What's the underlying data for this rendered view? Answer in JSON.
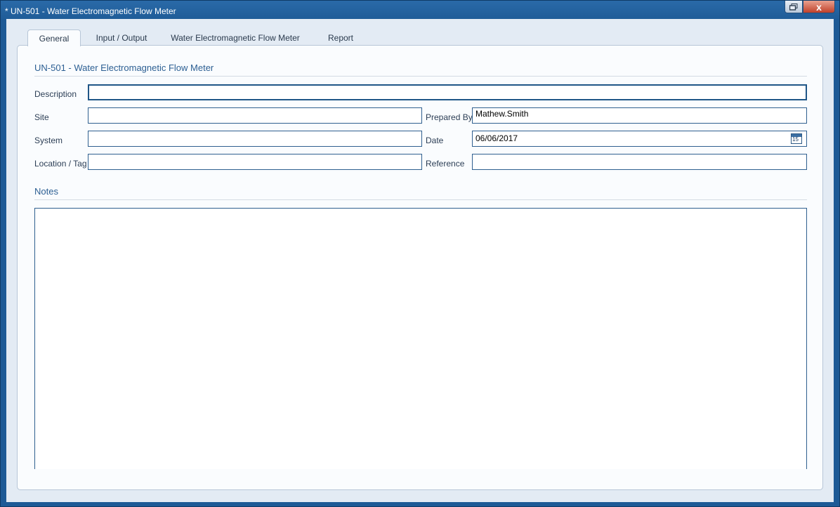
{
  "window": {
    "title": "* UN-501 - Water Electromagnetic Flow Meter",
    "restore_icon": "restore-icon",
    "close_icon": "close-icon",
    "close_glyph": "x"
  },
  "tabs": [
    {
      "label": "General",
      "active": true
    },
    {
      "label": "Input / Output",
      "active": false
    },
    {
      "label": "Water Electromagnetic Flow Meter",
      "active": false
    },
    {
      "label": "Report",
      "active": false
    }
  ],
  "general": {
    "section_title": "UN-501 - Water Electromagnetic Flow Meter",
    "fields": {
      "description": {
        "label": "Description",
        "value": ""
      },
      "site": {
        "label": "Site",
        "value": ""
      },
      "system": {
        "label": "System",
        "value": ""
      },
      "location": {
        "label": "Location / Tag",
        "value": ""
      },
      "prepared_by": {
        "label": "Prepared By",
        "value": "Mathew.Smith"
      },
      "date": {
        "label": "Date",
        "value": "06/06/2017",
        "calendar_day": "15"
      },
      "reference": {
        "label": "Reference",
        "value": ""
      }
    },
    "notes": {
      "title": "Notes",
      "value": ""
    }
  }
}
